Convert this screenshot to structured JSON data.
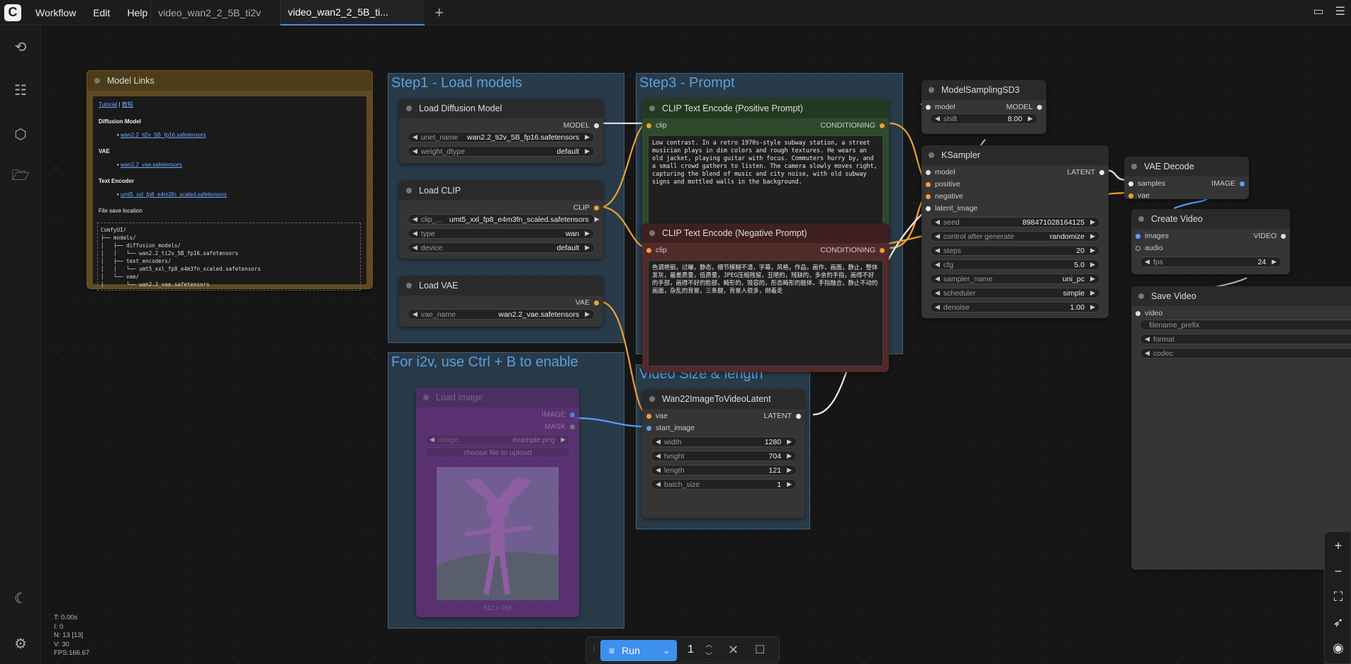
{
  "topbar": {
    "menu": [
      "Workflow",
      "Edit",
      "Help"
    ],
    "tabs": [
      "video_wan2_2_5B_ti2v",
      "video_wan2_2_5B_ti..."
    ],
    "new_tab": "+"
  },
  "groups": {
    "step1": "Step1 - Load models",
    "step3": "Step3 - Prompt",
    "i2v": "For i2v, use Ctrl + B to enable",
    "video": "Video Size & length"
  },
  "model_links": {
    "title": "Model Links",
    "tutorial": "Tutorial",
    "sep": "|",
    "tutorial_cn": "教程",
    "diffusion_label": "Diffusion Model",
    "diffusion_file": "wan2.2_ti2v_5B_fp16.safetensors",
    "vae_label": "VAE",
    "vae_file": "wan2.2_vae.safetensors",
    "te_label": "Text Encoder",
    "te_file": "umt5_xxl_fp8_e4m3fn_scaled.safetensors",
    "save_label": "File save location",
    "tree": [
      "ComfyUI/",
      "├── models/",
      "│   ├── diffusion_models/",
      "│   │   └── wan2.2_ti2v_5B_fp16.safetensors",
      "│   ├── text_encoders/",
      "│   │   └── umt5_xxl_fp8_e4m3fn_scaled.safetensors",
      "│   └── vae/",
      "│       └── wan2.2_vae.safetensors"
    ]
  },
  "load_diffusion": {
    "title": "Load Diffusion Model",
    "out": "MODEL",
    "w1_label": "unet_name",
    "w1_value": "wan2.2_ti2v_5B_fp16.safetensors",
    "w2_label": "weight_dtype",
    "w2_value": "default"
  },
  "load_clip": {
    "title": "Load CLIP",
    "out": "CLIP",
    "w1_label": "clip_...",
    "w1_value": "umt5_xxl_fp8_e4m3fn_scaled.safetensors",
    "w2_label": "type",
    "w2_value": "wan",
    "w3_label": "device",
    "w3_value": "default"
  },
  "load_vae": {
    "title": "Load VAE",
    "out": "VAE",
    "w1_label": "vae_name",
    "w1_value": "wan2.2_vae.safetensors"
  },
  "load_image": {
    "title": "Load Image",
    "out1": "IMAGE",
    "out2": "MASK",
    "w1_label": "image",
    "w1_value": "example.png",
    "upload": "choose file to upload",
    "caption": "512 × 768"
  },
  "clip_pos": {
    "title": "CLIP Text Encode (Positive Prompt)",
    "in": "clip",
    "out": "CONDITIONING",
    "text": "Low contrast. In a retro 1970s-style subway station, a street musician plays in dim colors and rough textures. He wears an old jacket, playing guitar with focus. Commuters hurry by, and a small crowd gathers to listen. The camera slowly moves right, capturing the blend of music and city noise, with old subway signs and mottled walls in the background."
  },
  "clip_neg": {
    "title": "CLIP Text Encode (Negative Prompt)",
    "in": "clip",
    "out": "CONDITIONING",
    "text": "色调艳丽，过曝，静态，细节模糊不清，字幕，风格，作品，画作，画面，静止，整体发灰，最差质量，低质量，JPEG压缩残留，丑陋的，残缺的，多余的手指，画得不好的手部，画得不好的脸部，畸形的，毁容的，形态畸形的肢体，手指融合，静止不动的画面，杂乱的背景，三条腿，背景人很多，倒着走"
  },
  "wan22": {
    "title": "Wan22ImageToVideoLatent",
    "in1": "vae",
    "in2": "start_image",
    "out": "LATENT",
    "w1_label": "width",
    "w1_value": "1280",
    "w2_label": "height",
    "w2_value": "704",
    "w3_label": "length",
    "w3_value": "121",
    "w4_label": "batch_size",
    "w4_value": "1"
  },
  "msd3": {
    "title": "ModelSamplingSD3",
    "in": "model",
    "out": "MODEL",
    "w1_label": "shift",
    "w1_value": "8.00"
  },
  "ksampler": {
    "title": "KSampler",
    "in1": "model",
    "in2": "positive",
    "in3": "negative",
    "in4": "latent_image",
    "out": "LATENT",
    "widgets": [
      [
        "seed",
        "898471028164125"
      ],
      [
        "control after generate",
        "randomize"
      ],
      [
        "steps",
        "20"
      ],
      [
        "cfg",
        "5.0"
      ],
      [
        "sampler_name",
        "uni_pc"
      ],
      [
        "scheduler",
        "simple"
      ],
      [
        "denoise",
        "1.00"
      ]
    ]
  },
  "vae_decode": {
    "title": "VAE Decode",
    "in1": "samples",
    "in2": "vae",
    "out": "IMAGE"
  },
  "create_video": {
    "title": "Create Video",
    "in1": "images",
    "in2": "audio",
    "out": "VIDEO",
    "w1_label": "fps",
    "w1_value": "24"
  },
  "save_video": {
    "title": "Save Video",
    "in": "video",
    "w1_label": "filename_prefix",
    "w2_label": "format",
    "w3_label": "codec"
  },
  "stats": [
    "T: 0.00s",
    "I: 0",
    "N: 13 [13]",
    "V: 30",
    "FPS:166.67"
  ],
  "runbar": {
    "run": "Run",
    "count": "1"
  }
}
